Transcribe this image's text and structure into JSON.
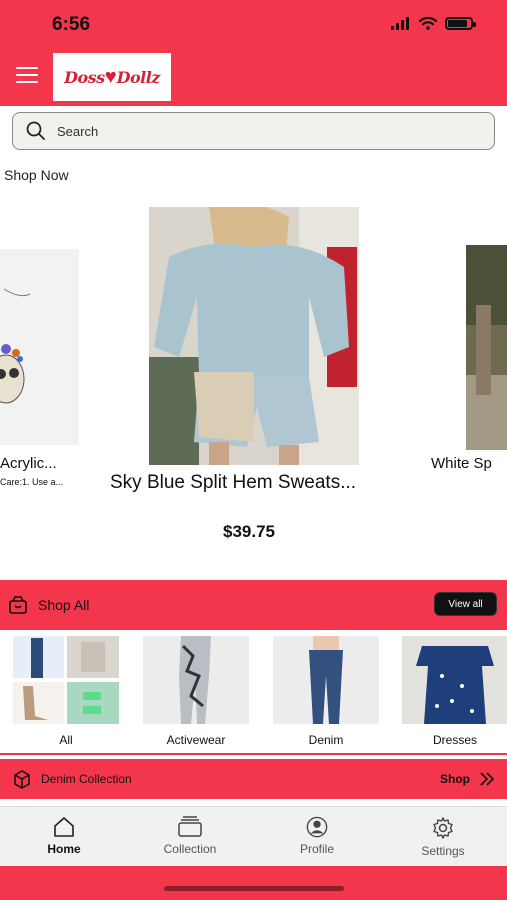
{
  "status_bar": {
    "time": "6:56",
    "battery_level": 0.85
  },
  "header": {
    "logo_text_left": "Doss",
    "logo_text_right": "Dollz"
  },
  "search": {
    "placeholder": "Search"
  },
  "shop_now": {
    "heading": "Shop Now"
  },
  "carousel": {
    "left_card": {
      "name": "Acrylic...",
      "description": "Care:1. Use a..."
    },
    "center_card": {
      "name": "Sky Blue Split Hem Sweats...",
      "price": "$39.75"
    },
    "right_card": {
      "name": "White Sp"
    }
  },
  "shop_all": {
    "title": "Shop All",
    "view_all_label": "View all",
    "categories": [
      {
        "label": "All"
      },
      {
        "label": "Activewear"
      },
      {
        "label": "Denim"
      },
      {
        "label": "Dresses"
      }
    ]
  },
  "denim_collection": {
    "title": "Denim Collection",
    "shop_label": "Shop"
  },
  "tab_bar": {
    "tabs": [
      {
        "label": "Home",
        "icon": "home-icon",
        "active": true
      },
      {
        "label": "Collection",
        "icon": "collection-icon",
        "active": false
      },
      {
        "label": "Profile",
        "icon": "profile-icon",
        "active": false
      },
      {
        "label": "Settings",
        "icon": "gear-icon",
        "active": false
      }
    ]
  },
  "colors": {
    "brand_red": "#f4364c",
    "logo_red": "#d71f35",
    "dark": "#111111"
  }
}
